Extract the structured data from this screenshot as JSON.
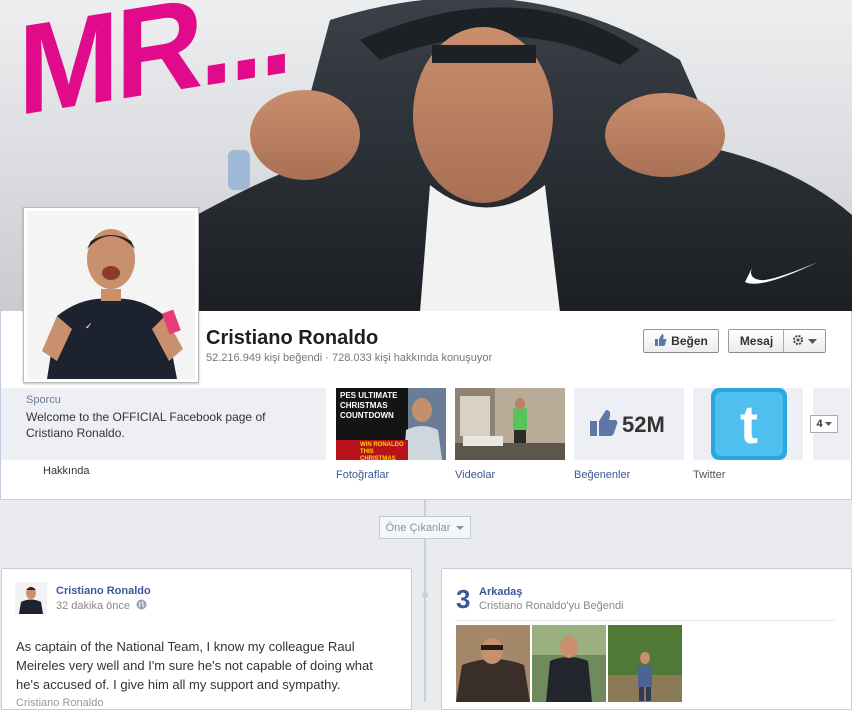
{
  "cover": {
    "text": "MR..."
  },
  "page": {
    "name": "Cristiano Ronaldo",
    "stats": "52.216.949 kişi beğendi · 728.033 kişi hakkında konuşuyor"
  },
  "actions": {
    "like_label": "Beğen",
    "message_label": "Mesaj"
  },
  "about": {
    "category": "Sporcu",
    "text": "Welcome to the OFFICIAL Facebook page of Cristiano Ronaldo.",
    "link_label": "Hakkında"
  },
  "apps": [
    {
      "label": "Fotoğraflar",
      "thumb_text": "PES ULTIMATE CHRISTMAS COUNTDOWN",
      "thumb_sub": "WIN RONALDO THIS CHRISTMAS"
    },
    {
      "label": "Videolar"
    },
    {
      "label": "Beğenenler",
      "count": "52M"
    },
    {
      "label": "Twitter"
    }
  ],
  "more_apps": "4",
  "timeline": {
    "highlights_label": "Öne Çıkanlar"
  },
  "post": {
    "author": "Cristiano Ronaldo",
    "time": "32 dakika önce",
    "text": "As captain of the National Team, I know my colleague Raul Meireles very well and I'm sure he's not capable of doing what he's accused of. I give him all my support and sympathy.",
    "footer": "Cristiano Ronaldo"
  },
  "friends": {
    "count": "3",
    "title": "Arkadaş",
    "subtitle": "Cristiano Ronaldo'yu Beğendi"
  },
  "colors": {
    "brand": "#3b5998",
    "cover_text": "#e10a8a",
    "twitter_blue": "#2aa7e0"
  }
}
